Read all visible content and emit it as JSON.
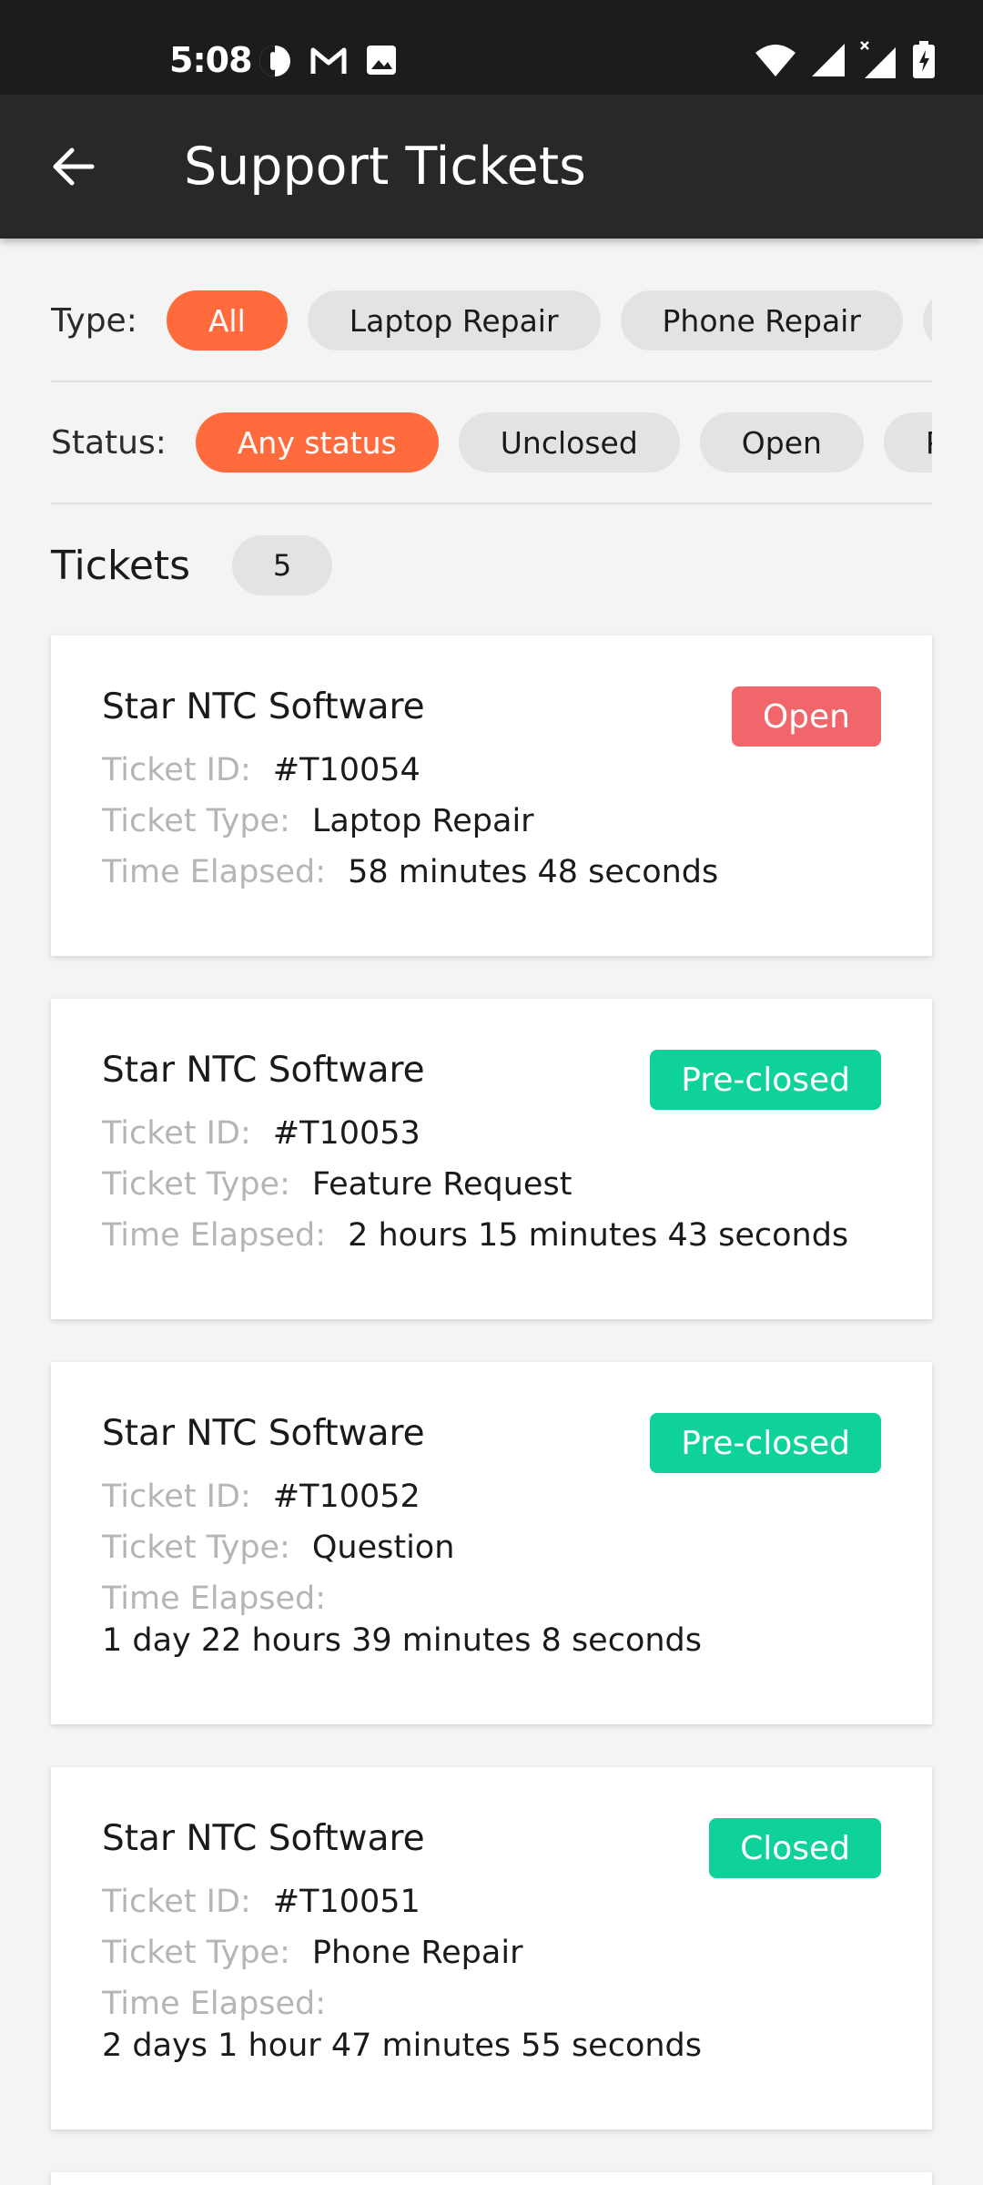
{
  "status_bar": {
    "time": "5:08",
    "left_icons": [
      "data-saver-icon",
      "gmail-icon",
      "gallery-icon"
    ],
    "right_icons": [
      "wifi-icon",
      "signal-icon",
      "signal-x-icon",
      "battery-charging-icon"
    ]
  },
  "app_bar": {
    "back_icon": "arrow-left-icon",
    "title": "Support Tickets"
  },
  "filters": {
    "type": {
      "label": "Type:",
      "chips": [
        "All",
        "Laptop Repair",
        "Phone Repair",
        ""
      ],
      "active": "All"
    },
    "status": {
      "label": "Status:",
      "chips": [
        "Any status",
        "Unclosed",
        "Open",
        "Pe"
      ],
      "active": "Any status"
    }
  },
  "tickets": {
    "header": "Tickets",
    "count": "5",
    "items": [
      {
        "company": "Star NTC Software",
        "status": "Open",
        "status_color": "#f0666b",
        "id_label": "Ticket ID:",
        "id": "#T10054",
        "type_label": "Ticket Type:",
        "type": "Laptop Repair",
        "elapsed_label": "Time Elapsed:",
        "elapsed": "58 minutes 48 seconds"
      },
      {
        "company": "Star NTC Software",
        "status": "Pre-closed",
        "status_color": "#0fd19a",
        "id_label": "Ticket ID:",
        "id": "#T10053",
        "type_label": "Ticket Type:",
        "type": "Feature Request",
        "elapsed_label": "Time Elapsed:",
        "elapsed": "2 hours 15 minutes 43 seconds"
      },
      {
        "company": "Star NTC Software",
        "status": "Pre-closed",
        "status_color": "#0fd19a",
        "id_label": "Ticket ID:",
        "id": "#T10052",
        "type_label": "Ticket Type:",
        "type": "Question",
        "elapsed_label": "Time Elapsed:",
        "elapsed": "1 day 22 hours 39 minutes 8 seconds"
      },
      {
        "company": "Star NTC Software",
        "status": "Closed",
        "status_color": "#0fd19a",
        "id_label": "Ticket ID:",
        "id": "#T10051",
        "type_label": "Ticket Type:",
        "type": "Phone Repair",
        "elapsed_label": "Time Elapsed:",
        "elapsed": "2 days 1 hour 47 minutes 55 seconds"
      }
    ]
  },
  "colors": {
    "accent": "#ff6b3d",
    "app_bar": "#2a2826",
    "open": "#f0666b",
    "closed": "#0fd19a"
  }
}
